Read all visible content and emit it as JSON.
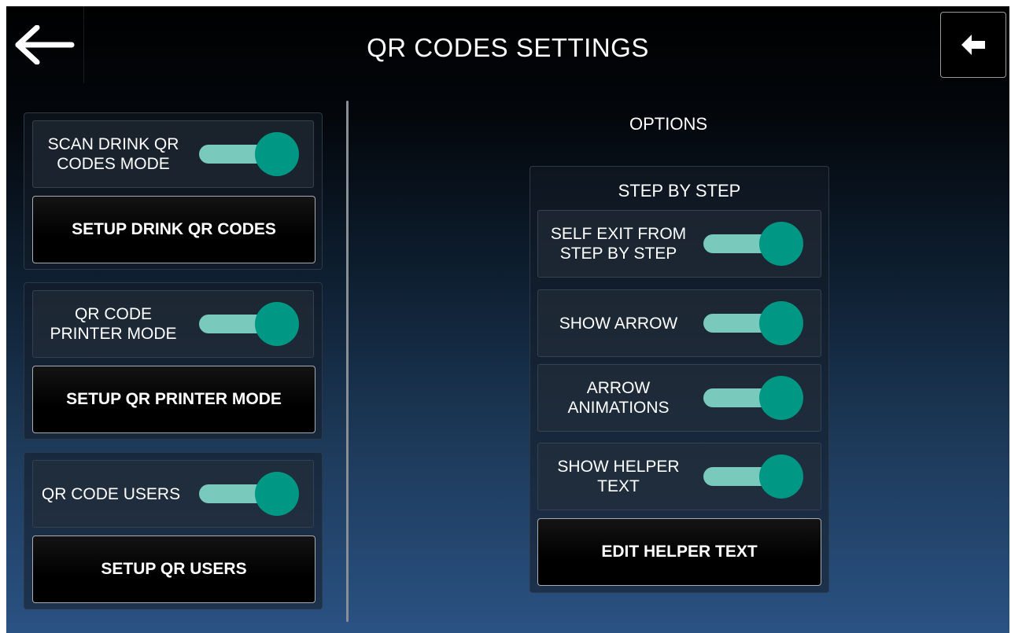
{
  "header": {
    "title": "QR CODES SETTINGS",
    "back_icon": "arrow-left-icon",
    "home_icon": "arrow-left-small-icon"
  },
  "left_panel": {
    "groups": [
      {
        "toggle_label_line1": "SCAN DRINK QR",
        "toggle_label_line2": "CODES MODE",
        "toggle_on": true,
        "button_label": "SETUP DRINK QR CODES"
      },
      {
        "toggle_label_line1": "QR CODE",
        "toggle_label_line2": "PRINTER MODE",
        "toggle_on": true,
        "button_label": "SETUP QR PRINTER MODE"
      },
      {
        "toggle_label_line1": "QR CODE USERS",
        "toggle_label_line2": "",
        "toggle_on": true,
        "button_label": "SETUP QR USERS"
      }
    ]
  },
  "right_panel": {
    "options_title": "OPTIONS",
    "step_by_step": {
      "title": "STEP BY STEP",
      "toggles": [
        {
          "label_line1": "SELF EXIT FROM",
          "label_line2": "STEP BY STEP",
          "on": true
        },
        {
          "label_line1": "SHOW ARROW",
          "label_line2": "",
          "on": true
        },
        {
          "label_line1": "ARROW",
          "label_line2": "ANIMATIONS",
          "on": true
        },
        {
          "label_line1": "SHOW HELPER",
          "label_line2": "TEXT",
          "on": true
        }
      ],
      "button_label": "EDIT HELPER TEXT"
    }
  },
  "colors": {
    "toggle_track": "#79c9bd",
    "toggle_knob": "#009784",
    "background_top": "#000000",
    "background_bottom": "#2a5283"
  }
}
